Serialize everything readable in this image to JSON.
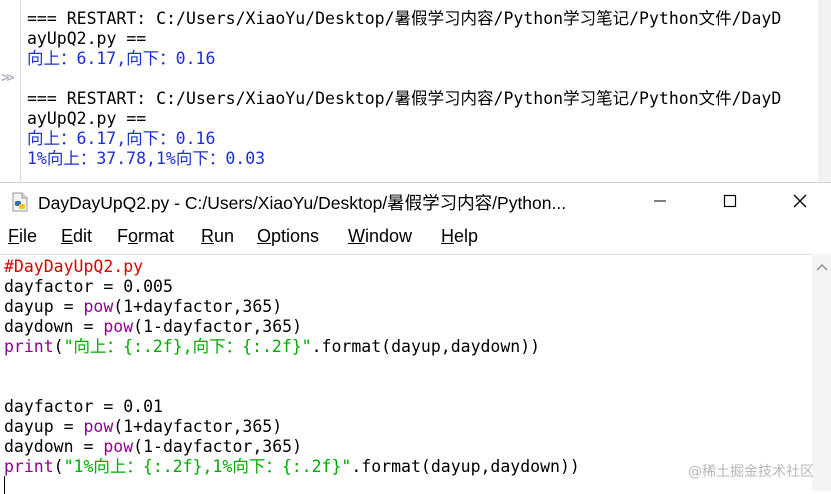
{
  "shell": {
    "lines": [
      "=== RESTART: C:/Users/XiaoYu/Desktop/暑假学习内容/Python学习笔记/Python文件/DayD",
      "ayUpQ2.py ==",
      "向上：6.17,向下：0.16",
      "=== RESTART: C:/Users/XiaoYu/Desktop/暑假学习内容/Python学习笔记/Python文件/DayD",
      "ayUpQ2.py ==",
      "向上：6.17,向下：0.16",
      "1%向上：37.78,1%向下：0.03"
    ],
    "prompt_glyph": ">>"
  },
  "editor": {
    "title": "DayDayUpQ2.py - C:/Users/XiaoYu/Desktop/暑假学习内容/Python...",
    "menu": [
      {
        "label": "File",
        "mnemonic": "F",
        "rest": "ile"
      },
      {
        "label": "Edit",
        "mnemonic": "E",
        "rest": "dit"
      },
      {
        "label": "Format",
        "mnemonic": "o",
        "pre": "F",
        "rest": "rmat"
      },
      {
        "label": "Run",
        "mnemonic": "R",
        "rest": "un"
      },
      {
        "label": "Options",
        "mnemonic": "O",
        "rest": "ptions"
      },
      {
        "label": "Window",
        "mnemonic": "W",
        "rest": "indow"
      },
      {
        "label": "Help",
        "mnemonic": "H",
        "rest": "elp"
      }
    ],
    "code": {
      "l1": "#DayDayUpQ2.py",
      "l2": "dayfactor = 0.005",
      "l3_a": "dayup = ",
      "l3_b": "pow",
      "l3_c": "(1+dayfactor,365)",
      "l4_a": "daydown = ",
      "l4_b": "pow",
      "l4_c": "(1-dayfactor,365)",
      "l5_a": "print",
      "l5_b": "(",
      "l5_c": "\"向上：{:.2f},向下：{:.2f}\"",
      "l5_d": ".format(dayup,daydown))",
      "l8": "dayfactor = 0.01",
      "l9_a": "dayup = ",
      "l9_b": "pow",
      "l9_c": "(1+dayfactor,365)",
      "l10_a": "daydown = ",
      "l10_b": "pow",
      "l10_c": "(1-dayfactor,365)",
      "l11_a": "print",
      "l11_b": "(",
      "l11_c": "\"1%向上：{:.2f},1%向下：{:.2f}\"",
      "l11_d": ".format(dayup,daydown))"
    }
  },
  "watermark": "@稀土掘金技术社区",
  "colors": {
    "comment": "#dd0000",
    "builtin": "#900090",
    "string": "#00aa00",
    "shell_output": "#1c2fd3"
  }
}
